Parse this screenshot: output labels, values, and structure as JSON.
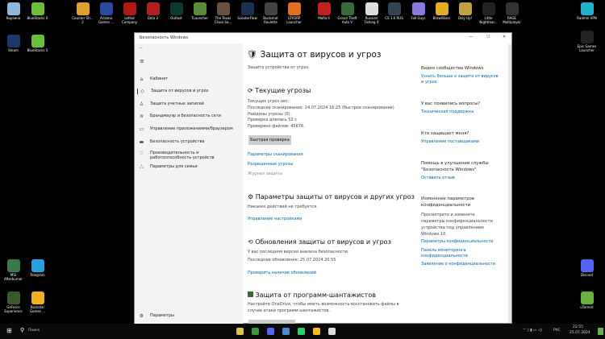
{
  "desktop": {
    "icons": [
      {
        "label": "Корзина",
        "color": "#8fb7d9"
      },
      {
        "label": "BlueStacks X",
        "color": "#6bbf3a"
      },
      {
        "label": "Counter Str... 2",
        "color": "#e0a030"
      },
      {
        "label": "Arizona Games ...",
        "color": "#2a4aa0"
      },
      {
        "label": "Lethal Company",
        "color": "#b01818"
      },
      {
        "label": "Dota 2",
        "color": "#b02020"
      },
      {
        "label": "Outlast",
        "color": "#0c3a30"
      },
      {
        "label": "TLauncher",
        "color": "#5a8a3a"
      },
      {
        "label": "The Texas Chain Sa...",
        "color": "#6a5040"
      },
      {
        "label": "ScooterFlow",
        "color": "#1a3050"
      },
      {
        "label": "Buckshot Roulette",
        "color": "#444"
      },
      {
        "label": "GTA5RP Launcher",
        "color": "#e07020"
      },
      {
        "label": "Mafia II",
        "color": "#c02020"
      },
      {
        "label": "Grand Theft Auto V",
        "color": "#3a6a3a"
      },
      {
        "label": "Russian Fishing 4",
        "color": "#ddd"
      },
      {
        "label": "CS 1.6 RUS",
        "color": "#334455"
      },
      {
        "label": "Fall Guys",
        "color": "#8a7ae0"
      },
      {
        "label": "BrawlStars",
        "color": "#e0b020"
      },
      {
        "label": "Only Up!",
        "color": "#c0a040"
      },
      {
        "label": "Little Nightmar...",
        "color": "#222"
      },
      {
        "label": "RAGE Multiplayer",
        "color": "#333"
      },
      {
        "label": "Radmin VPN",
        "color": "#20b0d0"
      },
      {
        "label": "Steam",
        "color": "#1b3a6a"
      },
      {
        "label": "BlueStacks 5",
        "color": "#6bbf3a"
      },
      {
        "label": "Epic Games Launcher",
        "color": "#222"
      },
      {
        "label": "MSI Afterburner",
        "color": "#3a7a4a"
      },
      {
        "label": "Telegram",
        "color": "#2aa0e0"
      },
      {
        "label": "GeForce Experience",
        "color": "#3a5a2a"
      },
      {
        "label": "Rockstar Games ...",
        "color": "#f0b020"
      },
      {
        "label": "Discord",
        "color": "#5865f2"
      },
      {
        "label": "uTorrent",
        "color": "#6ab040"
      }
    ]
  },
  "window": {
    "title": "Безопасность Windows",
    "controls": [
      "—",
      "☐",
      "✕"
    ]
  },
  "sidebar": {
    "items": [
      {
        "icon": "home-icon",
        "glyph": "⌂",
        "label": "Кабинет"
      },
      {
        "icon": "shield-icon",
        "glyph": "◇",
        "label": "Защита от вирусов и угроз"
      },
      {
        "icon": "person-icon",
        "glyph": "♙",
        "label": "Защита учетных записей"
      },
      {
        "icon": "wifi-icon",
        "glyph": "≋",
        "label": "Брандмауэр и безопасность сети"
      },
      {
        "icon": "app-browser-icon",
        "glyph": "▭",
        "label": "Управление приложениями/браузером"
      },
      {
        "icon": "laptop-icon",
        "glyph": "▬",
        "label": "Безопасность устройства"
      },
      {
        "icon": "heart-icon",
        "glyph": "♡",
        "label": "Производительность и работоспособность устройств"
      },
      {
        "icon": "family-icon",
        "glyph": "ஃ",
        "label": "Параметры для семьи"
      }
    ],
    "settings": "Параметры"
  },
  "main": {
    "title": "Защита от вирусов и угроз",
    "subtitle": "Защита устройства от угроз.",
    "current": {
      "heading": "Текущие угрозы",
      "lines": [
        "Текущих угроз нет.",
        "Последнее сканирование: 24.07.2024 16:25 (быстрое сканирование)",
        "Найдены угрозы (0).",
        "Проверка длилась 52 с",
        "Проверено файлов: 45676."
      ],
      "button": "Быстрая проверка",
      "links": [
        "Параметры сканирования",
        "Разрешенные угрозы",
        "Журнал защиты"
      ]
    },
    "settings": {
      "heading": "Параметры защиты от вирусов и других угроз",
      "text": "Никаких действий не требуется.",
      "link": "Управление настройками"
    },
    "updates": {
      "heading": "Обновления защиты от вирусов и угроз",
      "lines": [
        "У вас последняя версия анализа безопасности.",
        "Последнее обновление: 25.07.2024 20:55"
      ],
      "link": "Проверить наличие обновлений"
    },
    "ransom": {
      "heading": "Защита от программ-шантажистов",
      "lines": [
        "Настройте OneDrive, чтобы иметь возможность восстановить файлы в",
        "случае атаки программ-шантажистов."
      ]
    }
  },
  "right": {
    "video": {
      "title": "Видео сообщества Windows",
      "link": [
        "Узнать больше о защите от вирусов",
        "и угроз"
      ]
    },
    "questions": {
      "title": "У вас появились вопросы?",
      "link": "Техническая поддержка"
    },
    "who": {
      "title": "Кто защищает меня?",
      "link": "Управление поставщиками"
    },
    "help": {
      "title": [
        "Помощь в улучшении службы",
        "\"Безопасность Windows\""
      ],
      "link": "Оставить отзыв"
    },
    "privacy": {
      "title": [
        "Изменение параметров",
        "конфиденциальности"
      ],
      "text": [
        "Просмотрите и измените",
        "параметры конфиденциальности",
        "устройства под управлением",
        "Windows 10."
      ],
      "links": [
        "Параметры конфиденциальности",
        "Панель мониторинга",
        "конфиденциальности",
        "Заявление о конфиденциальности"
      ]
    }
  },
  "taskbar": {
    "search": "Поиск",
    "apps": [
      {
        "name": "file-explorer",
        "color": "#e0c050"
      },
      {
        "name": "app-green",
        "color": "#3a9a3a"
      },
      {
        "name": "discord",
        "color": "#5865f2"
      },
      {
        "name": "app-check",
        "color": "#4a8ad0"
      },
      {
        "name": "whatsapp",
        "color": "#25d366"
      },
      {
        "name": "yandex-browser",
        "color": "#f0c020"
      },
      {
        "name": "windows-security",
        "color": "#ddd"
      }
    ],
    "lang": "РУС",
    "time": "22:55",
    "date": "25.07.2024"
  }
}
